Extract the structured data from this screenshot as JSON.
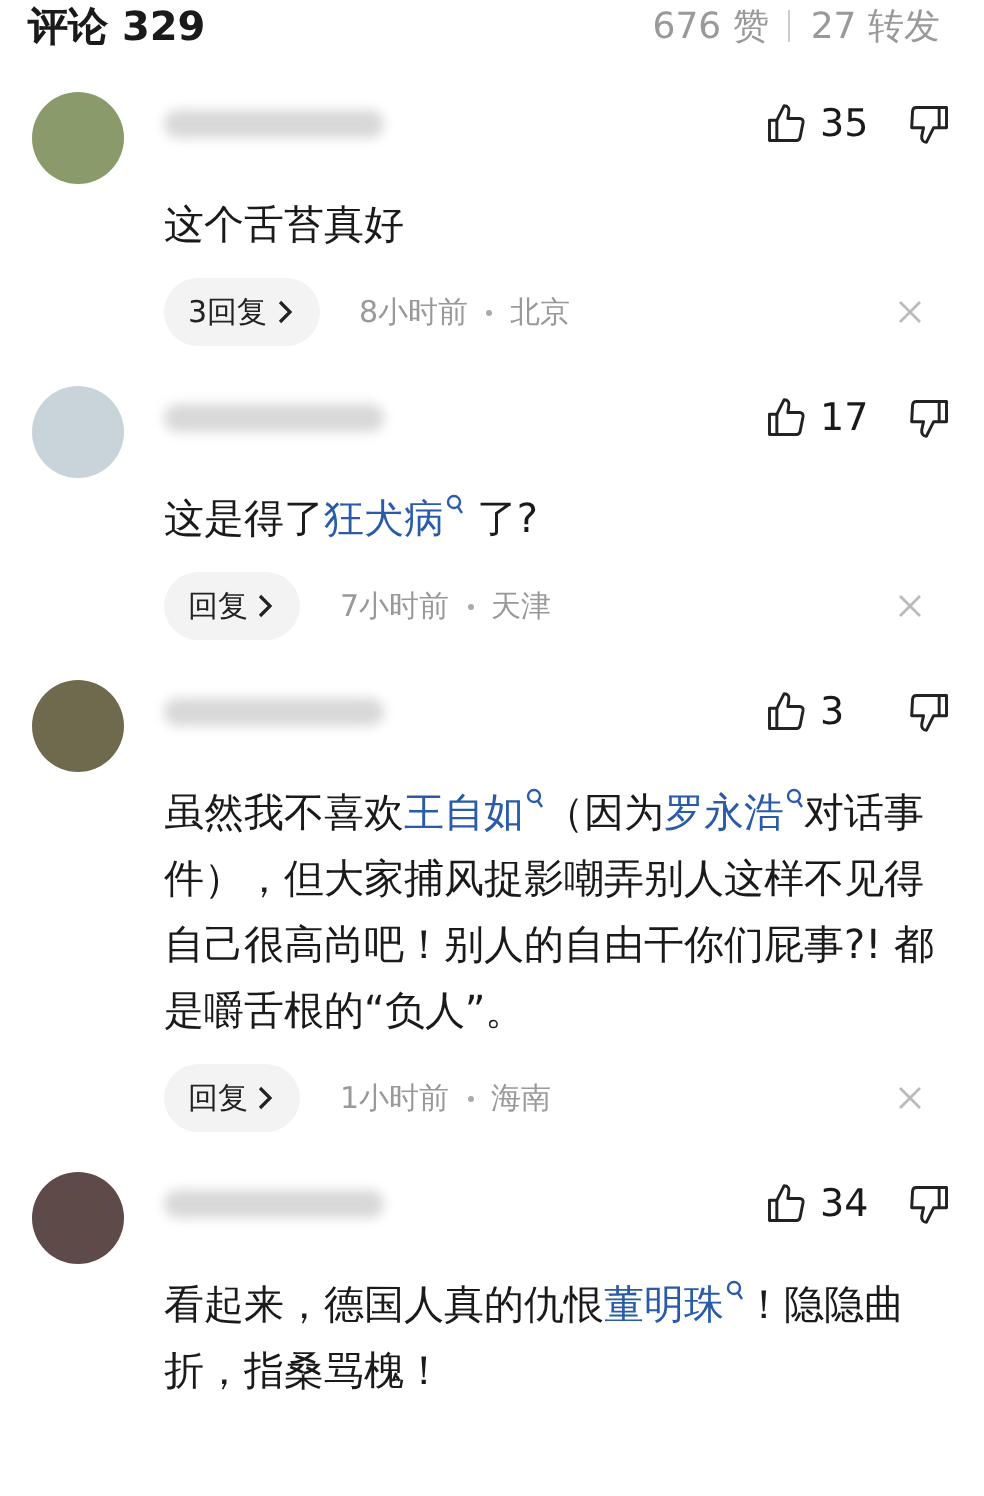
{
  "header": {
    "title": "评论 329",
    "likes": "676 赞",
    "reposts": "27 转发"
  },
  "comments": [
    {
      "avatar": {
        "color": "#8a9a6a"
      },
      "likes": "35",
      "segments": [
        {
          "kind": "text",
          "text": "这个舌苔真好"
        }
      ],
      "reply_label": "3回复",
      "time": "8小时前",
      "location": "北京"
    },
    {
      "avatar": {
        "color": "#c9d3da"
      },
      "likes": "17",
      "segments": [
        {
          "kind": "text",
          "text": "这是得了"
        },
        {
          "kind": "link",
          "text": "狂犬病"
        },
        {
          "kind": "text",
          "text": " 了?"
        }
      ],
      "reply_label": "回复",
      "time": "7小时前",
      "location": "天津"
    },
    {
      "avatar": {
        "color": "#6f6a4e"
      },
      "likes": "3",
      "segments": [
        {
          "kind": "text",
          "text": "虽然我不喜欢"
        },
        {
          "kind": "link",
          "text": "王自如"
        },
        {
          "kind": "text",
          "text": "（因为"
        },
        {
          "kind": "link",
          "text": "罗永浩"
        },
        {
          "kind": "text",
          "text": "对话事件），但大家捕风捉影嘲弄别人这样不见得自己很高尚吧！别人的自由干你们屁事?! 都是嚼舌根的“负人”。"
        }
      ],
      "reply_label": "回复",
      "time": "1小时前",
      "location": "海南"
    },
    {
      "avatar": {
        "color": "#5e4a48"
      },
      "likes": "34",
      "segments": [
        {
          "kind": "text",
          "text": "看起来，德国人真的仇恨"
        },
        {
          "kind": "link",
          "text": "董明珠"
        },
        {
          "kind": "text",
          "text": "！隐隐曲折，指桑骂槐！"
        }
      ]
    }
  ]
}
